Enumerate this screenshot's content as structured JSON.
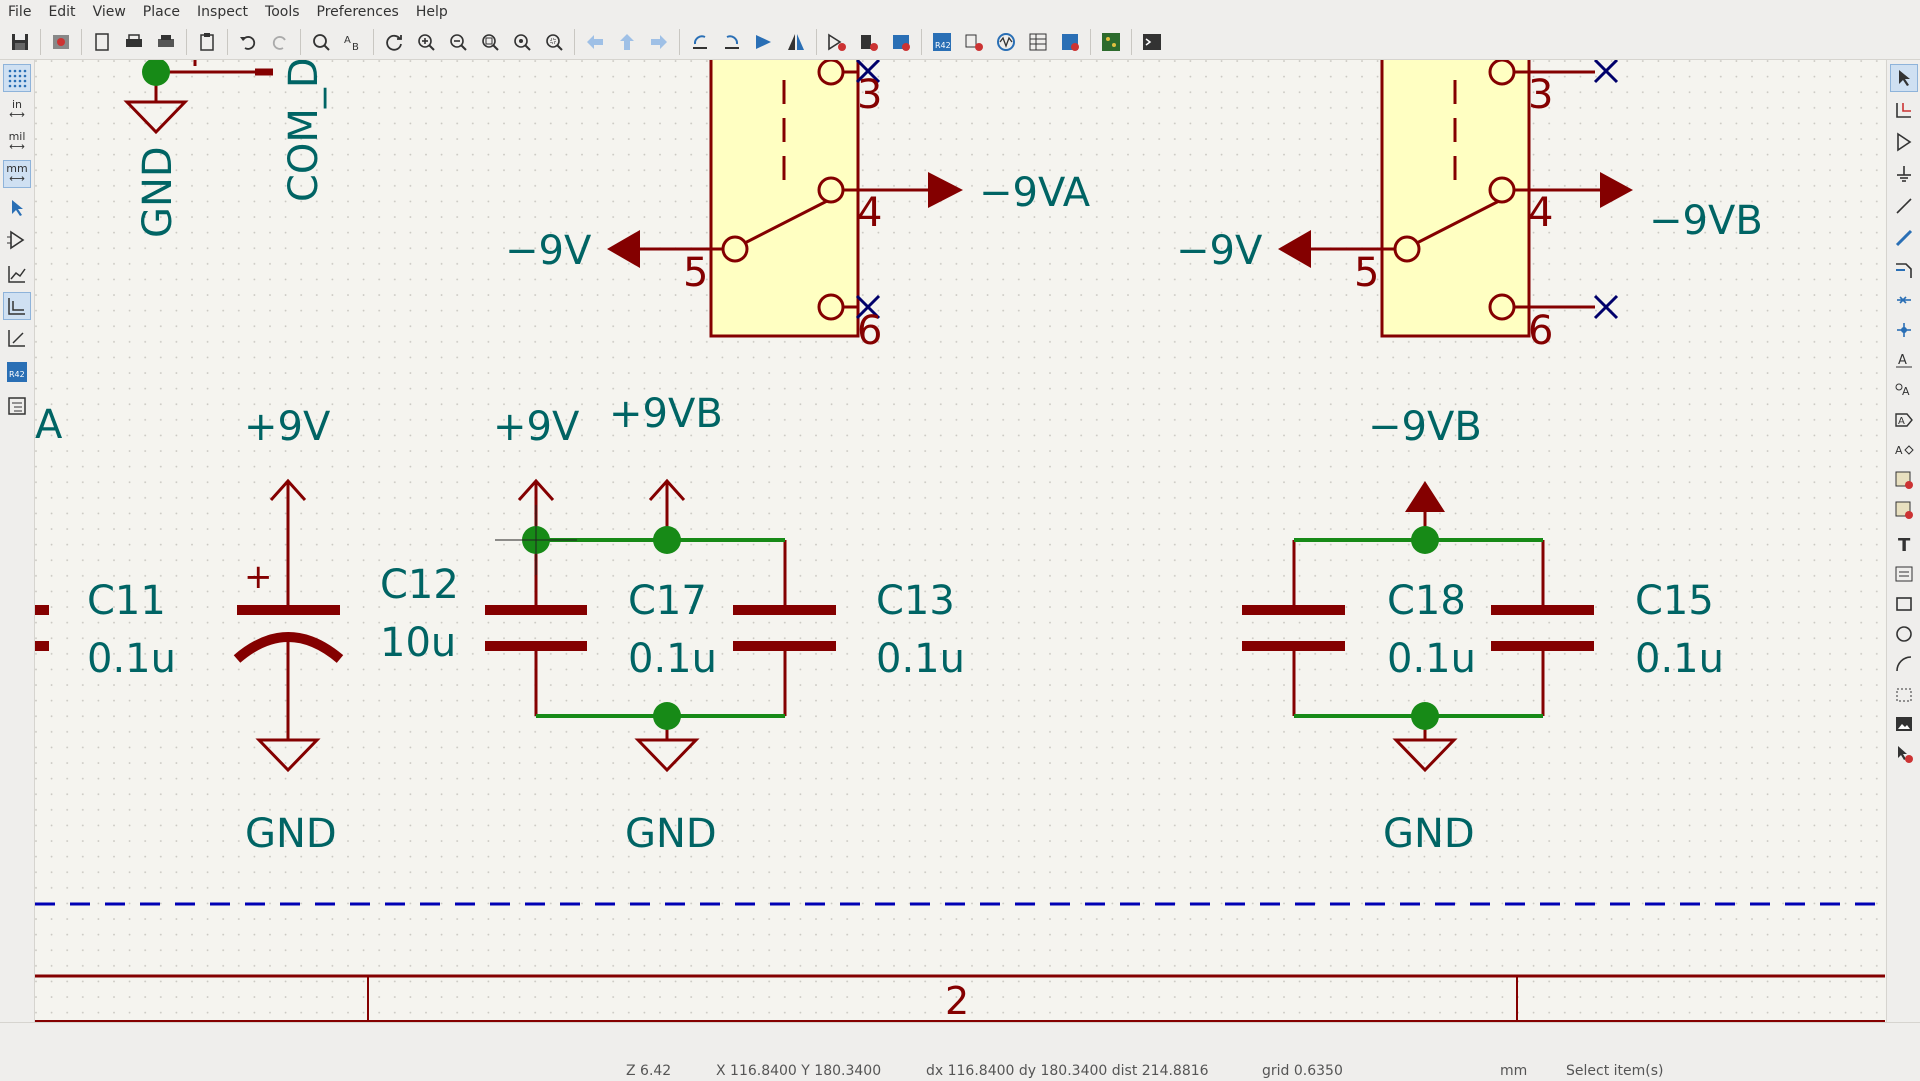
{
  "menu": [
    "File",
    "Edit",
    "View",
    "Place",
    "Inspect",
    "Tools",
    "Preferences",
    "Help"
  ],
  "toolbar": [
    "save-icon",
    "schematic-setup-icon",
    "page-settings-icon",
    "print-icon",
    "plot-icon",
    "paste-icon",
    "undo-icon",
    "redo-icon",
    "find-icon",
    "find-replace-icon",
    "refresh-icon",
    "zoom-in-icon",
    "zoom-out-icon",
    "zoom-fit-icon",
    "zoom-objects-icon",
    "zoom-selection-icon",
    "navigate-back-icon",
    "navigate-up-icon",
    "navigate-forward-icon",
    "rotate-ccw-icon",
    "rotate-cw-icon",
    "mirror-horizontal-icon",
    "mirror-vertical-icon",
    "symbol-editor-icon",
    "symbol-browser-icon",
    "footprint-assign-icon",
    "annotate-icon",
    "erc-icon",
    "simulator-icon",
    "symbol-fields-table-icon",
    "bom-icon",
    "pcb-editor-icon",
    "scripting-console-icon"
  ],
  "left_toolbar": {
    "units_in": "in",
    "units_mil": "mil",
    "units_mm": "mm",
    "annotate_label": "R42"
  },
  "schematic": {
    "labels": {
      "gnd_top": "GND",
      "com_d": "COM_D",
      "neg9va": "−9VA",
      "neg9v_left": "−9V",
      "neg9v_right": "−9V",
      "neg9vb_right": "−9VB",
      "plus9v_1": "+9V",
      "plus9v_2": "+9V",
      "plus9vb": "+9VB",
      "neg9vb": "−9VB",
      "gnd_1": "GND",
      "gnd_2": "GND",
      "gnd_3": "GND",
      "partial_a": "A",
      "plus_sign": "+"
    },
    "pins": {
      "left_3": "3",
      "left_4": "4",
      "left_5": "5",
      "left_6": "6",
      "right_3": "3",
      "right_4": "4",
      "right_5": "5",
      "right_6": "6"
    },
    "components": [
      {
        "ref": "C11",
        "value": "0.1u"
      },
      {
        "ref": "C12",
        "value": "10u"
      },
      {
        "ref": "C17",
        "value": "0.1u"
      },
      {
        "ref": "C13",
        "value": "0.1u"
      },
      {
        "ref": "C18",
        "value": "0.1u"
      },
      {
        "ref": "C15",
        "value": "0.1u"
      }
    ],
    "sheet_zone_number": "2"
  },
  "status": {
    "zoom": "Z 6.42",
    "cursor": "X 116.8400  Y 180.3400",
    "delta": "dx 116.8400  dy 180.3400  dist 214.8816",
    "grid": "grid 0.6350",
    "units": "mm",
    "mode": "Select item(s)"
  },
  "colors": {
    "wire": "#178a17",
    "component": "#840000",
    "text": "#006464",
    "body_fill": "#ffffc2",
    "no_connect": "#00006b",
    "dashed_line": "#0000b4"
  }
}
